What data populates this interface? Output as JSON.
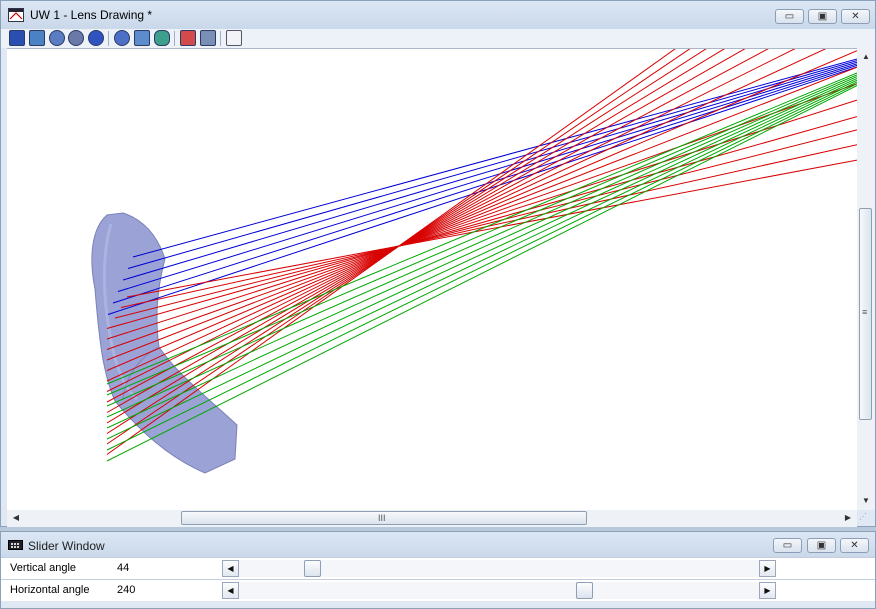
{
  "main_window": {
    "title": "UW 1 - Lens Drawing *",
    "controls": {
      "minimize": "▭",
      "maximize": "▣",
      "close": "✕"
    },
    "toolbar_icons": [
      "layout-icon",
      "lens-settings-icon",
      "shaded-model-icon",
      "wireframe-icon",
      "3d-view-icon",
      "rotate-icon",
      "ray-settings-icon",
      "surface-icon",
      "zoom-icon",
      "refresh-icon",
      "table-icon"
    ],
    "colors": {
      "ray_blue": "#0000d8",
      "ray_red": "#d80000",
      "ray_green": "#00a800",
      "lens_fill": "#9aa2d6"
    },
    "scroll_glyphs": {
      "up": "▲",
      "down": "▼",
      "left": "◀",
      "right": "▶",
      "grip_v": "≡",
      "grip_h": "III",
      "size": "⋰"
    }
  },
  "slider_window": {
    "title": "Slider Window",
    "controls": {
      "minimize": "▭",
      "maximize": "▣",
      "close": "✕"
    },
    "sliders": [
      {
        "label": "Vertical angle",
        "value": "44",
        "position_fraction": 0.13
      },
      {
        "label": "Horizontal angle",
        "value": "240",
        "position_fraction": 0.67
      }
    ],
    "arrows": {
      "left": "◀",
      "right": "▶"
    }
  }
}
